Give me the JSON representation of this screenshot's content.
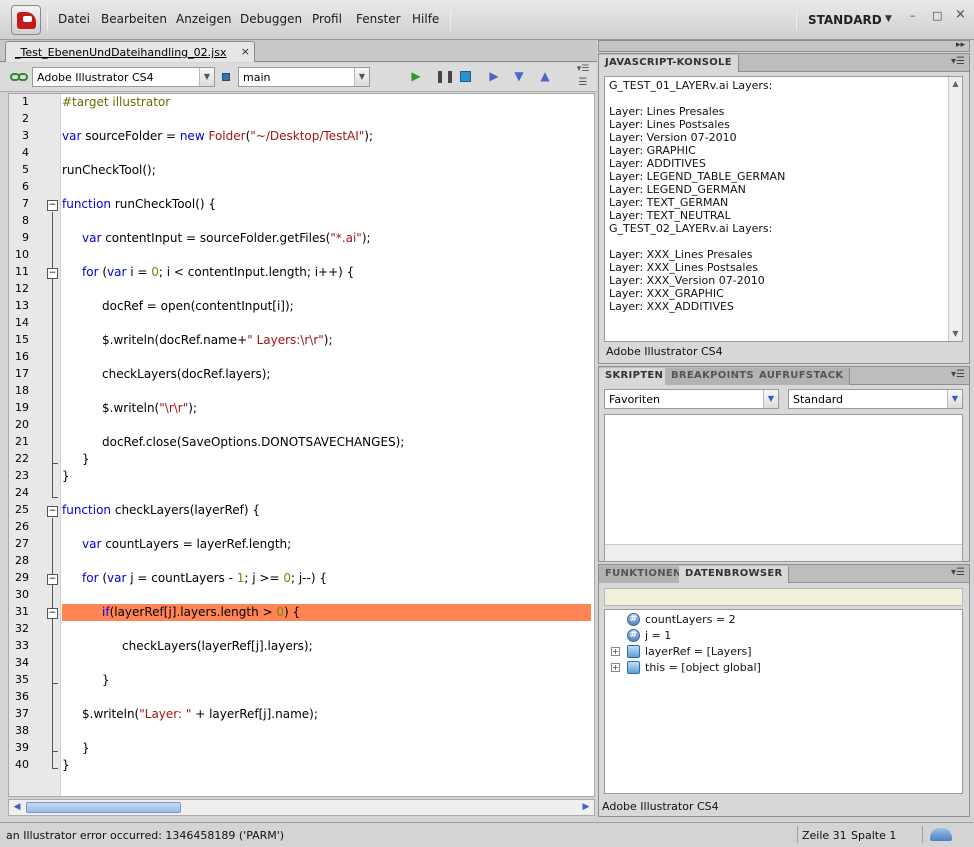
{
  "menubar": {
    "items": [
      "Datei",
      "Bearbeiten",
      "Anzeigen",
      "Debuggen",
      "Profil",
      "Fenster",
      "Hilfe"
    ],
    "workspace": "STANDARD",
    "window_buttons": {
      "close": "×",
      "minimize": "–",
      "maximize": "□"
    }
  },
  "editor": {
    "tab_label": "_Test_EbenenUndDateihandling_02.jsx",
    "tab_close": "×",
    "target_app": "Adobe Illustrator CS4",
    "engine": "main",
    "line_numbers": [
      "1",
      "2",
      "3",
      "4",
      "5",
      "6",
      "7",
      "8",
      "9",
      "10",
      "11",
      "12",
      "13",
      "14",
      "15",
      "16",
      "17",
      "18",
      "19",
      "20",
      "21",
      "22",
      "23",
      "24",
      "25",
      "26",
      "27",
      "28",
      "29",
      "30",
      "31",
      "32",
      "33",
      "34",
      "35",
      "36",
      "37",
      "38",
      "39",
      "40"
    ],
    "highlighted_line": 31,
    "code": {
      "l1": "#target illustrator",
      "l3a": "var",
      "l3b": " sourceFolder = ",
      "l3c": "new",
      "l3d": " ",
      "l3e": "Folder",
      "l3f": "(",
      "l3g": "\"~/Desktop/TestAI\"",
      "l3h": ");",
      "l5": "runCheckTool();",
      "l7a": "function",
      "l7b": " runCheckTool() {",
      "l9a": "var",
      "l9b": " contentInput = sourceFolder.getFiles(",
      "l9c": "\"*.ai\"",
      "l9d": ");",
      "l11a": "for",
      "l11b": " (",
      "l11c": "var",
      "l11d": " i = ",
      "l11e": "0",
      "l11f": "; i < contentInput.length; i++) {",
      "l13": "docRef = open(contentInput[i]);",
      "l15a": "$.writeln(docRef.name+",
      "l15b": "\" Layers:\\r\\r\"",
      "l15c": ");",
      "l17": "checkLayers(docRef.layers);",
      "l19a": "$.writeln(",
      "l19b": "\"\\r\\r\"",
      "l19c": ");",
      "l21": "docRef.close(SaveOptions.DONOTSAVECHANGES);",
      "l22": "}",
      "l23": "}",
      "l25a": "function",
      "l25b": " checkLayers(layerRef) {",
      "l27a": "var",
      "l27b": " countLayers = layerRef.length;",
      "l29a": "for",
      "l29b": " (",
      "l29c": "var",
      "l29d": " j = countLayers - ",
      "l29e": "1",
      "l29f": "; j >= ",
      "l29g": "0",
      "l29h": "; j--) {",
      "l31a": "if",
      "l31b": "(layerRef[j].layers.length > ",
      "l31c": "0",
      "l31d": ") {",
      "l33": "checkLayers(layerRef[j].layers);",
      "l35": "}",
      "l37a": "$.writeln(",
      "l37b": "\"Layer: \"",
      "l37c": " + layerRef[j].name);",
      "l39": "}",
      "l40": "}"
    }
  },
  "console": {
    "tab": "JAVASCRIPT-KONSOLE",
    "lines": [
      "G_TEST_01_LAYERv.ai Layers:",
      "",
      "Layer: Lines Presales",
      "Layer: Lines Postsales",
      "Layer: Version 07-2010",
      "Layer: GRAPHIC",
      "Layer: ADDITIVES",
      "Layer: LEGEND_TABLE_GERMAN",
      "Layer: LEGEND_GERMAN",
      "Layer: TEXT_GERMAN",
      "Layer: TEXT_NEUTRAL",
      "G_TEST_02_LAYERv.ai Layers:",
      "",
      "Layer: XXX_Lines Presales",
      "Layer: XXX_Lines Postsales",
      "Layer: XXX_Version 07-2010",
      "Layer: XXX_GRAPHIC",
      "Layer: XXX_ADDITIVES"
    ],
    "footer": "Adobe Illustrator CS4"
  },
  "scripts_panel": {
    "tabs": [
      "SKRIPTEN",
      "BREAKPOINTS",
      "AUFRUFSTACK"
    ],
    "favorites": "Favoriten",
    "standard": "Standard"
  },
  "data_panel": {
    "tabs": [
      "FUNKTIONEN",
      "DATENBROWSER"
    ],
    "rows": [
      {
        "text": "countLayers = 2",
        "icon": "hash-icon",
        "expandable": false
      },
      {
        "text": "j = 1",
        "icon": "hash-icon",
        "expandable": false
      },
      {
        "text": "layerRef = [Layers]",
        "icon": "object-icon",
        "expandable": true
      },
      {
        "text": "this = [object global]",
        "icon": "object-icon",
        "expandable": true
      }
    ],
    "footer": "Adobe Illustrator CS4"
  },
  "statusbar": {
    "message": "an Illustrator error occurred: 1346458189 ('PARM')",
    "line": "Zeile 31",
    "column": "Spalte 1"
  },
  "colors": {
    "highlight": "#ff8456",
    "keyword": "#0000d4",
    "string": "#a31515"
  }
}
